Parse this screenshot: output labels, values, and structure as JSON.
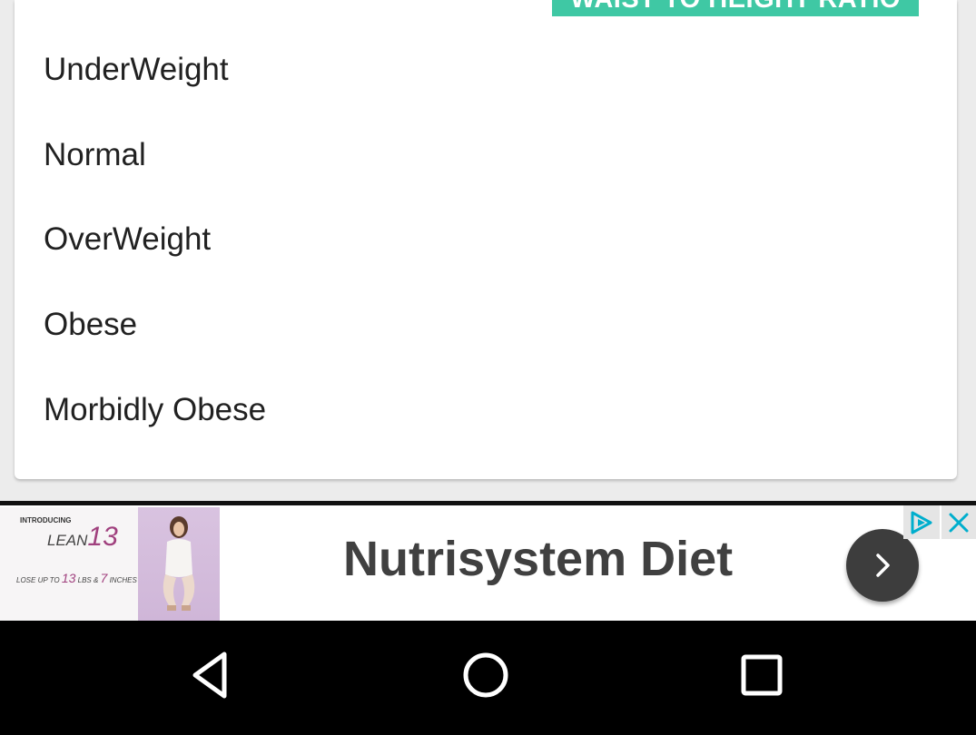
{
  "header": {
    "ratio_tab_label": "WAIST TO HEIGHT RATIO"
  },
  "categories": [
    {
      "label": "UnderWeight"
    },
    {
      "label": "Normal"
    },
    {
      "label": "OverWeight"
    },
    {
      "label": "Obese"
    },
    {
      "label": "Morbidly Obese"
    }
  ],
  "ad": {
    "title": "Nutrisystem Diet",
    "thumb_intro": "INTRODUCING",
    "thumb_brand": "LEAN",
    "thumb_brand_number": "13",
    "thumb_tag_prefix": "LOSE UP TO",
    "thumb_tag_lbs_num": "13",
    "thumb_tag_lbs": "LBS &",
    "thumb_tag_inches_num": "7",
    "thumb_tag_inches": "INCHES",
    "icons": {
      "adchoices": "adchoices-icon",
      "close": "close-icon",
      "go": "chevron-right-icon"
    },
    "colors": {
      "accent": "#3fc8a4",
      "go_button": "#3d3d3d",
      "adchoices": "#00aecd"
    }
  },
  "navbar": {
    "icons": [
      "back-icon",
      "home-icon",
      "recents-icon"
    ]
  }
}
